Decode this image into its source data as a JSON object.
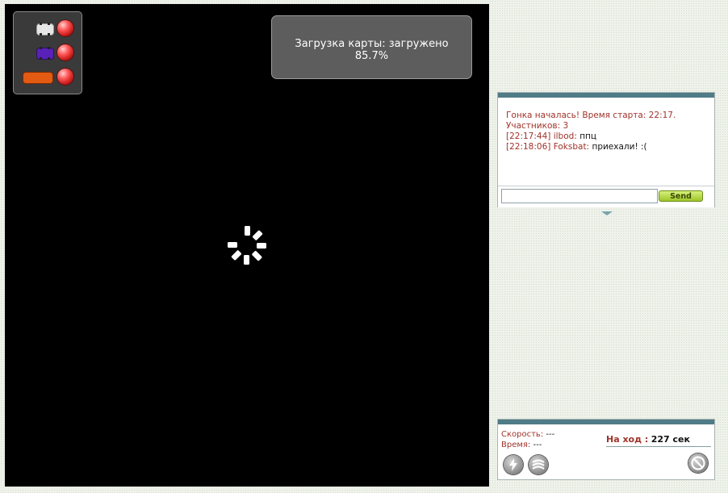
{
  "loading": {
    "line1": "Загрузка карты: загружено",
    "line2": "85.7%"
  },
  "players": [
    {
      "car_color": "#e6e6e6",
      "status_color": "#ff3b3b"
    },
    {
      "car_color": "#5a21b8",
      "status_color": "#ff3b3b"
    },
    {
      "car_color": "#e35a12",
      "status_color": "#ff3b3b"
    }
  ],
  "chat": {
    "messages": [
      {
        "time": "",
        "author": "",
        "text": "Гонка началась! Время старта: 22:17."
      },
      {
        "time": "",
        "author": "",
        "text": "Участников: 3"
      },
      {
        "time": "[22:17:44]",
        "author": "ilbod:",
        "text": "ппц"
      },
      {
        "time": "[22:18:06]",
        "author": "Foksbat:",
        "text": "приехали! :("
      }
    ],
    "input_value": "",
    "send_label": "Send"
  },
  "stats": {
    "speed_label": "Скорость:",
    "speed_value": "---",
    "time_label": "Время:",
    "time_value": "---",
    "turn_label": "На ход :",
    "turn_value": "227 сек"
  },
  "icons": {
    "nitro": "lightning-icon",
    "wave": "wave-icon",
    "quit": "no-entry-icon"
  },
  "colors": {
    "accent_bar": "#4f7c87",
    "chat_red": "#a0332a",
    "send_green": "#9fc62a"
  }
}
